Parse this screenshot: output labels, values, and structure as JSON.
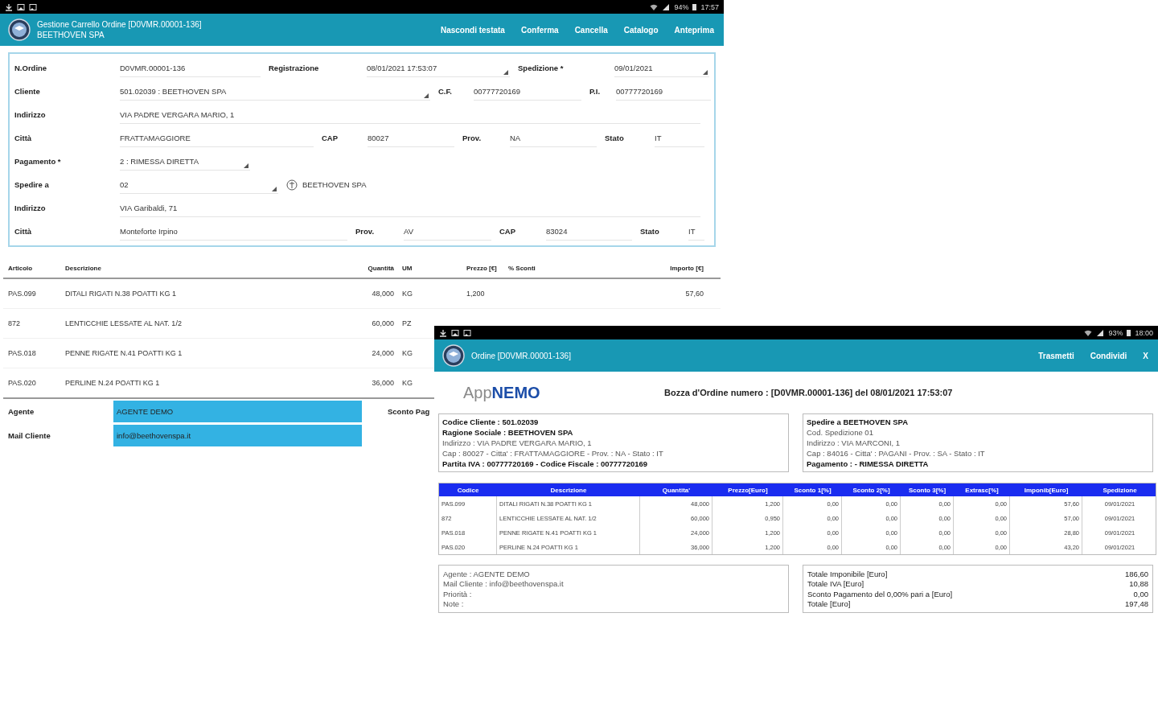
{
  "order_window": {
    "status_bar": {
      "battery": "94%",
      "time": "17:57"
    },
    "title": "Gestione Carrello Ordine [D0VMR.00001-136]",
    "subtitle": "BEETHOVEN SPA",
    "actions": [
      "Nascondi testata",
      "Conferma",
      "Cancella",
      "Catalogo",
      "Anteprima"
    ],
    "form_rows": [
      [
        {
          "label": "N.Ordine",
          "value": "D0VMR.00001-136",
          "kind": "text"
        },
        {
          "label": "Registrazione",
          "value": "08/01/2021 17:53:07",
          "kind": "select"
        },
        {
          "label": "Spedizione *",
          "value": "09/01/2021",
          "kind": "select"
        }
      ],
      [
        {
          "label": "Cliente",
          "value": "501.02039 : BEETHOVEN SPA",
          "kind": "select"
        },
        {
          "label": "C.F.",
          "value": "00777720169",
          "kind": "text"
        },
        {
          "label": "P.I.",
          "value": "00777720169",
          "kind": "text"
        }
      ],
      [
        {
          "label": "Indirizzo",
          "value": "VIA PADRE VERGARA MARIO, 1",
          "kind": "text"
        }
      ],
      [
        {
          "label": "Città",
          "value": "FRATTAMAGGIORE",
          "kind": "text"
        },
        {
          "label": "CAP",
          "value": "80027",
          "kind": "text"
        },
        {
          "label": "Prov.",
          "value": "NA",
          "kind": "text"
        },
        {
          "label": "Stato",
          "value": "IT",
          "kind": "text"
        }
      ],
      [
        {
          "label": "Pagamento *",
          "value": "2 : RIMESSA DIRETTA",
          "kind": "select"
        }
      ],
      [
        {
          "label": "Spedire a",
          "value": "02",
          "kind": "select",
          "linked_name": "BEETHOVEN SPA"
        }
      ],
      [
        {
          "label": "Indirizzo",
          "value": "VIA Garibaldi, 71",
          "kind": "text"
        }
      ],
      [
        {
          "label": "Città",
          "value": "Monteforte Irpino",
          "kind": "text"
        },
        {
          "label": "Prov.",
          "value": "AV",
          "kind": "text"
        },
        {
          "label": "CAP",
          "value": "83024",
          "kind": "text"
        },
        {
          "label": "Stato",
          "value": "IT",
          "kind": "text"
        }
      ]
    ],
    "table": {
      "columns": [
        "Articolo",
        "Descrizione",
        "Quantità",
        "UM",
        "Prezzo [€]",
        "% Sconti",
        "Importo [€]"
      ],
      "rows": [
        {
          "article": "PAS.099",
          "description": "DITALI RIGATI N.38 POATTI KG 1",
          "quantity": "48,000",
          "unit": "KG",
          "price": "1,200",
          "amount": "57,60"
        },
        {
          "article": "872",
          "description": "LENTICCHIE LESSATE AL NAT. 1/2",
          "quantity": "60,000",
          "unit": "PZ"
        },
        {
          "article": "PAS.018",
          "description": "PENNE RIGATE N.41 POATTI KG 1",
          "quantity": "24,000",
          "unit": "KG"
        },
        {
          "article": "PAS.020",
          "description": "PERLINE N.24 POATTI KG 1",
          "quantity": "36,000",
          "unit": "KG"
        }
      ]
    },
    "footer_fields": [
      {
        "label": "Agente",
        "value": "AGENTE DEMO"
      },
      {
        "label": "Mail Cliente",
        "value": "info@beethovenspa.it"
      }
    ],
    "payment_discount_label": "Sconto Pag"
  },
  "preview_window": {
    "status_bar": {
      "battery": "93%",
      "time": "18:00"
    },
    "title": "Ordine [D0VMR.00001-136]",
    "actions": [
      "Trasmetti",
      "Condividi",
      "X"
    ],
    "logo": {
      "prefix": "App",
      "name": "NEMO"
    },
    "heading": "Bozza d'Ordine numero : [D0VMR.00001-136] del 08/01/2021 17:53:07",
    "customer_box": [
      {
        "text": "Codice Cliente : 501.02039",
        "bold": true
      },
      {
        "text": "Ragione Sociale : BEETHOVEN SPA",
        "bold": true
      },
      {
        "text": "Indirizzo : VIA PADRE VERGARA MARIO, 1",
        "bold": false
      },
      {
        "text": "Cap : 80027 - Citta' : FRATTAMAGGIORE - Prov. : NA - Stato : IT",
        "bold": false
      },
      {
        "text": "Partita IVA : 00777720169 - Codice Fiscale : 00777720169",
        "bold": true
      }
    ],
    "shipping_box": [
      {
        "text": "Spedire a BEETHOVEN SPA",
        "bold": true
      },
      {
        "text": "Cod. Spedizione 01",
        "bold": false
      },
      {
        "text": "Indirizzo : VIA MARCONI, 1",
        "bold": false
      },
      {
        "text": "Cap : 84016 - Citta' : PAGANI - Prov. : SA - Stato : IT",
        "bold": false
      },
      {
        "text": "Pagamento : - RIMESSA DIRETTA",
        "bold": true
      }
    ],
    "table": {
      "columns": [
        "Codice",
        "Descrizione",
        "Quantita'",
        "Prezzo[Euro]",
        "Sconto 1[%]",
        "Sconto 2[%]",
        "Sconto 3[%]",
        "Extrasc[%]",
        "Imponib[Euro]",
        "Spedizione"
      ],
      "rows": [
        [
          "PAS.099",
          "DITALI RIGATI N.38 POATTI KG 1",
          "48,000",
          "1,200",
          "0,00",
          "0,00",
          "0,00",
          "0,00",
          "57,60",
          "09/01/2021"
        ],
        [
          "872",
          "LENTICCHIE LESSATE AL NAT. 1/2",
          "60,000",
          "0,950",
          "0,00",
          "0,00",
          "0,00",
          "0,00",
          "57,00",
          "09/01/2021"
        ],
        [
          "PAS.018",
          "PENNE RIGATE N.41 POATTI KG 1",
          "24,000",
          "1,200",
          "0,00",
          "0,00",
          "0,00",
          "0,00",
          "28,80",
          "09/01/2021"
        ],
        [
          "PAS.020",
          "PERLINE N.24 POATTI KG 1",
          "36,000",
          "1,200",
          "0,00",
          "0,00",
          "0,00",
          "0,00",
          "43,20",
          "09/01/2021"
        ]
      ]
    },
    "notes_box": [
      "Agente : AGENTE DEMO",
      "Mail Cliente : info@beethovenspa.it",
      "Priorità :",
      "Note :"
    ],
    "totals": [
      {
        "label": "Totale Imponibile [Euro]",
        "value": "186,60"
      },
      {
        "label": "Totale IVA [Euro]",
        "value": "10,88"
      },
      {
        "label": "Sconto Pagamento del 0,00% pari a [Euro]",
        "value": "0,00"
      },
      {
        "label": "Totale [Euro]",
        "value": "197,48"
      }
    ]
  }
}
